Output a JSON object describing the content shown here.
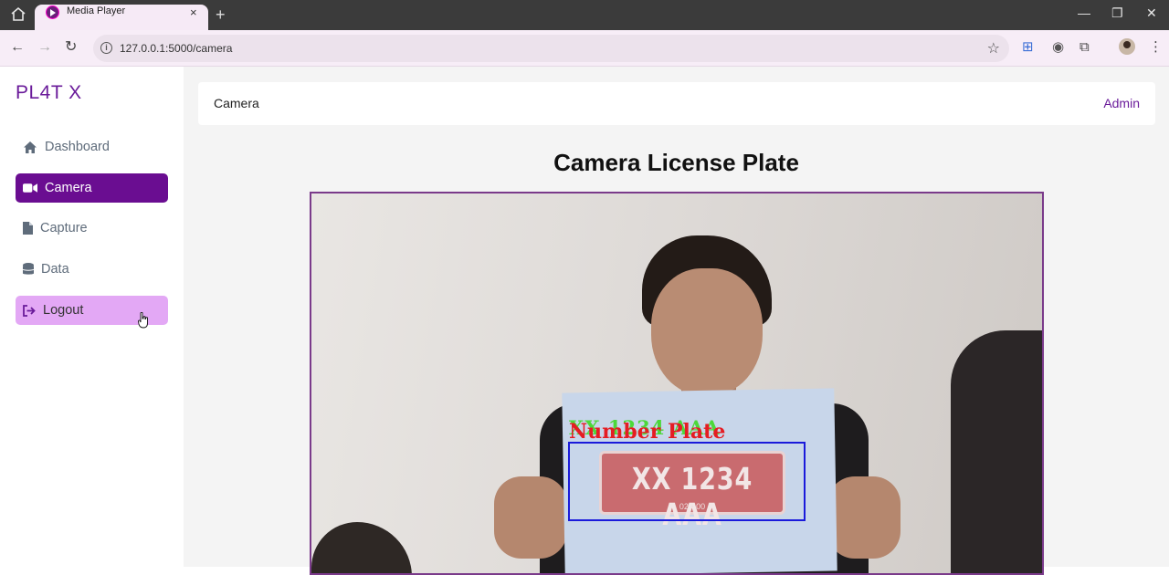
{
  "browser": {
    "tab_title": "Media Player",
    "tab_close": "×",
    "new_tab": "+",
    "url": "127.0.0.1:5000/camera",
    "window_controls": [
      "—",
      "❐",
      "✕"
    ]
  },
  "sidebar": {
    "brand": "PL4T X",
    "items": [
      {
        "label": "Dashboard",
        "icon": "home-icon",
        "state": "normal"
      },
      {
        "label": "Camera",
        "icon": "video-camera-icon",
        "state": "active"
      },
      {
        "label": "Capture",
        "icon": "file-icon",
        "state": "normal"
      },
      {
        "label": "Data",
        "icon": "database-icon",
        "state": "normal"
      },
      {
        "label": "Logout",
        "icon": "logout-icon",
        "state": "hover"
      }
    ]
  },
  "topbar": {
    "title": "Camera",
    "user": "Admin"
  },
  "main": {
    "heading": "Camera License Plate"
  },
  "camera_feed": {
    "ocr_text": "XX 1234 AAA",
    "detection_label": "Number Plate",
    "plate_number": "XX 1234 AAA",
    "plate_sub": "02 • 00"
  },
  "colors": {
    "brand": "#6a1b9a",
    "active_nav": "#6a0d91",
    "hover_nav": "#e3a8f5",
    "detection_box": "#1a1adb",
    "ocr_green": "#4dd83a",
    "label_red": "#e51c23"
  }
}
